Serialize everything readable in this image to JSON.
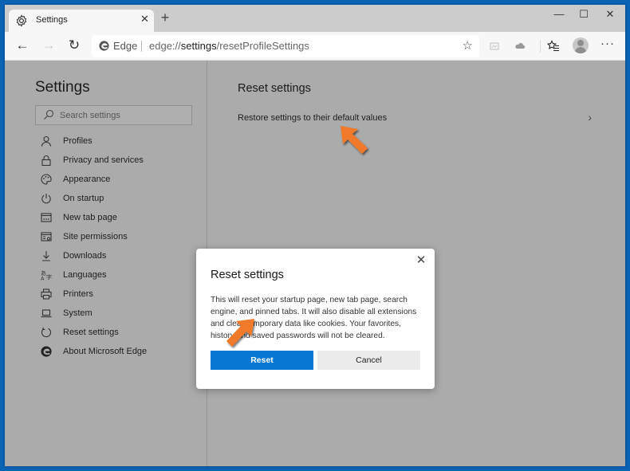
{
  "window": {
    "tab_title": "Settings",
    "tab_icon": "gear-icon",
    "controls": {
      "minimize": "—",
      "maximize": "☐",
      "close": "✕"
    },
    "new_tab": "+"
  },
  "toolbar": {
    "back": "←",
    "forward": "→",
    "refresh": "↻",
    "address": {
      "site_label": "Edge",
      "url_prefix": "edge://",
      "url_host": "settings",
      "url_path": "/resetProfileSettings"
    },
    "more": "···"
  },
  "sidebar": {
    "title": "Settings",
    "search_placeholder": "Search settings",
    "items": [
      {
        "label": "Profiles",
        "icon": "person-icon"
      },
      {
        "label": "Privacy and services",
        "icon": "lock-icon"
      },
      {
        "label": "Appearance",
        "icon": "palette-icon"
      },
      {
        "label": "On startup",
        "icon": "power-icon"
      },
      {
        "label": "New tab page",
        "icon": "new-tab-page-icon"
      },
      {
        "label": "Site permissions",
        "icon": "site-permissions-icon"
      },
      {
        "label": "Downloads",
        "icon": "download-icon"
      },
      {
        "label": "Languages",
        "icon": "languages-icon"
      },
      {
        "label": "Printers",
        "icon": "printer-icon"
      },
      {
        "label": "System",
        "icon": "laptop-icon"
      },
      {
        "label": "Reset settings",
        "icon": "reset-icon"
      },
      {
        "label": "About Microsoft Edge",
        "icon": "edge-logo-icon"
      }
    ]
  },
  "main": {
    "title": "Reset settings",
    "restore_label": "Restore settings to their default values",
    "chevron": "›"
  },
  "dialog": {
    "title": "Reset settings",
    "close": "✕",
    "body": "This will reset your startup page, new tab page, search engine, and pinned tabs. It will also disable all extensions and clear temporary data like cookies. Your favorites, history and saved passwords will not be cleared.",
    "primary_label": "Reset",
    "secondary_label": "Cancel"
  },
  "colors": {
    "accent": "#0878d4",
    "annotation_arrow": "#f07a2c",
    "desktop": "#0a63b3",
    "overlay": "#ababab"
  }
}
